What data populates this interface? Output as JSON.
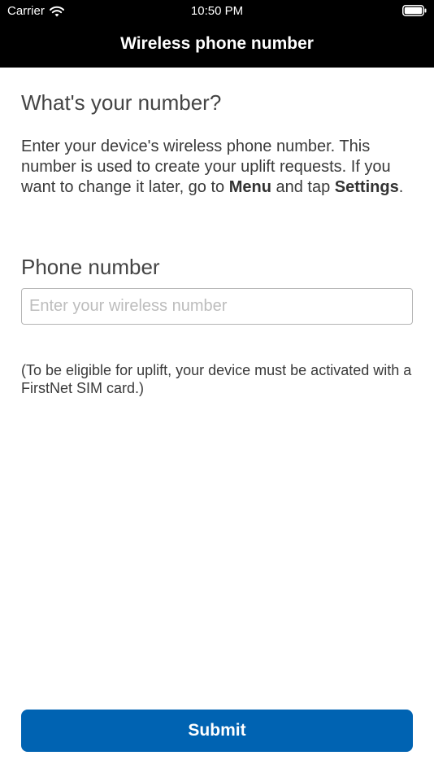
{
  "status_bar": {
    "carrier": "Carrier",
    "time": "10:50 PM"
  },
  "header": {
    "title": "Wireless phone number"
  },
  "main": {
    "heading": "What's your number?",
    "intro": {
      "text_before_menu": "Enter your device's wireless phone number. This number is used to create your uplift requests. If you want to change it later, go to ",
      "menu_word": "Menu",
      "text_between": " and tap ",
      "settings_word": "Settings",
      "text_end": "."
    },
    "phone_label": "Phone number",
    "phone_input": {
      "value": "",
      "placeholder": "Enter your wireless number"
    },
    "note": "(To be eligible for uplift, your device must be activated with a FirstNet SIM card.)",
    "submit_label": "Submit"
  },
  "colors": {
    "header_bg": "#000000",
    "accent": "#0063b2",
    "text": "#3a3a3a"
  }
}
